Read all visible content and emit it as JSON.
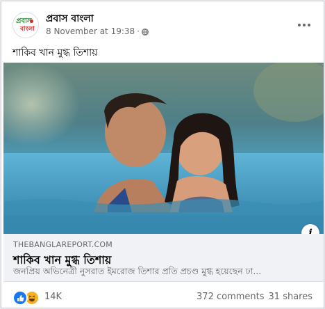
{
  "post": {
    "page_name": "প্রবাস বাংলা",
    "timestamp": "8 November at 19:38",
    "separator": "·",
    "audience_icon": "globe-icon",
    "text": "শাকিব খান মুগ্ধ তিশায়",
    "avatar_text_line1": "প্রবাস",
    "avatar_text_line2": "বাংলা"
  },
  "link_preview": {
    "domain": "THEBANGLAREPORT.COM",
    "title": "শাকিব খান মুগ্ধ তিশায়",
    "description": "জনপ্রিয় অভিনেত্রী নুসরাত ইমরোজ তিশার প্রতি প্রচণ্ড মুগ্ধ হয়েছেন ঢা..."
  },
  "footer": {
    "reaction_icons": [
      "like-icon",
      "haha-icon"
    ],
    "reaction_count": "14K",
    "comments": "372 comments",
    "shares": "31 shares"
  },
  "colors": {
    "facebook_blue": "#1877f2",
    "haha_yellow": "#f7b125",
    "secondary_text": "#65676b",
    "link_box_bg": "#f0f2f5"
  }
}
